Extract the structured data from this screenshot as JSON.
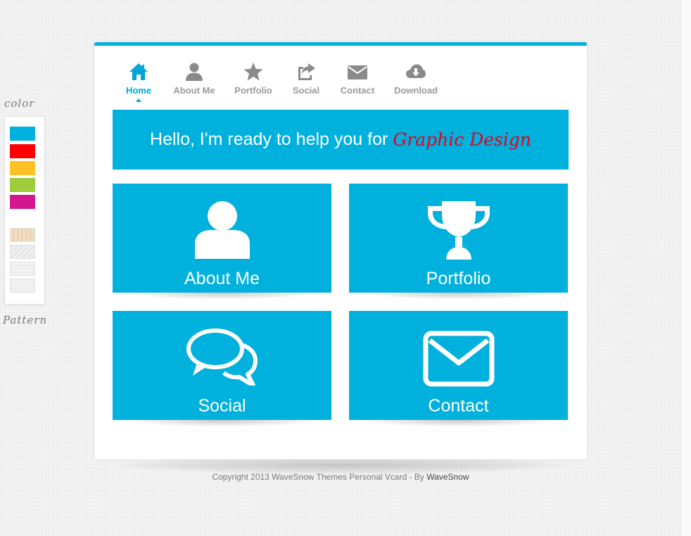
{
  "switcher": {
    "color_label": "color",
    "pattern_label": "Pattern",
    "colors": [
      "#00b0dd",
      "#ff0000",
      "#ffc125",
      "#9ecc3a",
      "#d4168f"
    ]
  },
  "nav": {
    "items": [
      {
        "label": "Home",
        "icon": "home-icon",
        "active": true
      },
      {
        "label": "About Me",
        "icon": "user-icon"
      },
      {
        "label": "Portfolio",
        "icon": "star-icon"
      },
      {
        "label": "Social",
        "icon": "share-icon"
      },
      {
        "label": "Contact",
        "icon": "envelope-icon"
      },
      {
        "label": "Download",
        "icon": "cloud-download-icon"
      }
    ]
  },
  "banner": {
    "text": "Hello, I'm ready to help you for",
    "accent": "Graphic Design"
  },
  "tiles": [
    {
      "label": "About Me",
      "icon": "user-icon"
    },
    {
      "label": "Portfolio",
      "icon": "trophy-icon"
    },
    {
      "label": "Social",
      "icon": "chat-bubbles-icon"
    },
    {
      "label": "Contact",
      "icon": "envelope-icon"
    }
  ],
  "footer": {
    "text": "Copyright 2013 WaveSnow Themes Personal Vcard - By",
    "link": "WaveSnow"
  },
  "colors": {
    "accent": "#00b0dd",
    "banner_accent_text": "#e8001c",
    "nav_inactive": "#9a9a9a"
  }
}
